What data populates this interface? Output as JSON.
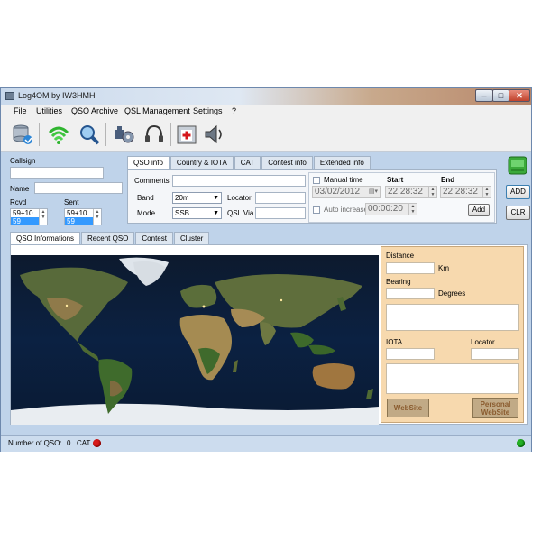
{
  "window": {
    "title": "Log4OM by IW3HMH",
    "min": "–",
    "max": "□",
    "close": "✕"
  },
  "menu": [
    "File",
    "Utilities",
    "QSO Archive",
    "QSL Management",
    "Settings",
    "?"
  ],
  "toolbar": [
    "database-icon",
    "wifi-signal-icon",
    "magnifier-icon",
    "puzzle-gear-icon",
    "headset-icon",
    "first-aid-icon",
    "speaker-icon"
  ],
  "left": {
    "callsign_label": "Callsign",
    "callsign_value": "",
    "name_label": "Name",
    "name_value": "",
    "rcvd_label": "Rcvd",
    "sent_label": "Sent",
    "rcvd_values": [
      "59+10",
      "59"
    ],
    "sent_values": [
      "59+10",
      "59"
    ]
  },
  "tabs": {
    "items": [
      "QSO info",
      "Country & IOTA",
      "CAT",
      "Contest info",
      "Extended info"
    ],
    "active": 0
  },
  "qso": {
    "comments_label": "Comments",
    "comments_value": "",
    "band_label": "Band",
    "band_value": "20m",
    "locator_label": "Locator",
    "locator_value": "",
    "mode_label": "Mode",
    "mode_value": "SSB",
    "qslvia_label": "QSL Via",
    "qslvia_value": ""
  },
  "time": {
    "manual_label": "Manual time",
    "start_label": "Start",
    "end_label": "End",
    "date_value": "03/02/2012",
    "start_value": "22:28:32",
    "end_value": "22:28:32",
    "auto_label": "Auto increase",
    "auto_value": "00:00:20",
    "add_label": "Add"
  },
  "side_buttons": {
    "add_label": "ADD",
    "clr_label": "CLR"
  },
  "bottom_tabs": {
    "items": [
      "QSO Informations",
      "Recent QSO",
      "Contest",
      "Cluster"
    ],
    "active": 0
  },
  "info": {
    "distance_label": "Distance",
    "distance_unit": "Km",
    "bearing_label": "Bearing",
    "bearing_unit": "Degrees",
    "iota_label": "IOTA",
    "locator_label": "Locator",
    "website_label": "WebSite",
    "personal_line1": "Personal",
    "personal_line2": "WebSite"
  },
  "status": {
    "qso_label": "Number of QSO:",
    "qso_count": "0",
    "cat_label": "CAT",
    "cat_color": "#d81a1a",
    "right_color": "#25b225"
  }
}
